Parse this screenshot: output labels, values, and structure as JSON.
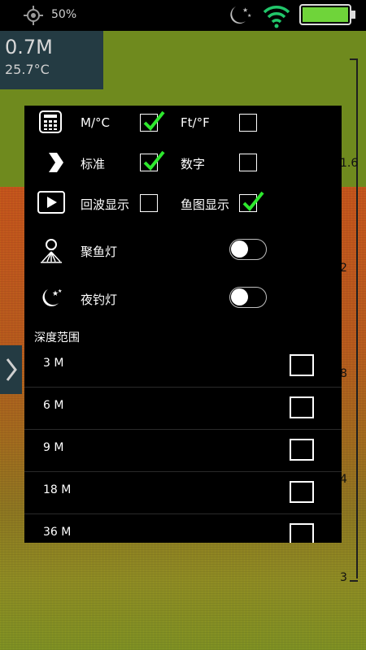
{
  "status": {
    "battery_pct": "50%",
    "colors": {
      "wifi": "#21c66a",
      "battery": "#6fd43a"
    },
    "icons": [
      "gps-icon",
      "moon-stars-icon",
      "wifi-icon",
      "battery-icon"
    ]
  },
  "readout": {
    "depth": "0.7M",
    "temperature": "25.7°C"
  },
  "scale": {
    "labels": [
      "1.6",
      "2",
      "8",
      "4",
      "3"
    ]
  },
  "settings": {
    "units": {
      "metric_label": "M/°C",
      "metric_checked": true,
      "imperial_label": "Ft/°F",
      "imperial_checked": false
    },
    "display": {
      "standard_label": "标准",
      "standard_checked": true,
      "digital_label": "数字",
      "digital_checked": false
    },
    "sonar": {
      "echo_label": "回波显示",
      "echo_checked": false,
      "fish_label": "鱼图显示",
      "fish_checked": true
    },
    "fish_light": {
      "label": "聚鱼灯",
      "on": false
    },
    "night_light": {
      "label": "夜钓灯",
      "on": false
    },
    "depth_range": {
      "title": "深度范围",
      "options": [
        {
          "label": "3 M",
          "checked": false
        },
        {
          "label": "6 M",
          "checked": false
        },
        {
          "label": "9 M",
          "checked": false
        },
        {
          "label": "18 M",
          "checked": false
        },
        {
          "label": "36 M",
          "checked": false
        }
      ]
    }
  }
}
